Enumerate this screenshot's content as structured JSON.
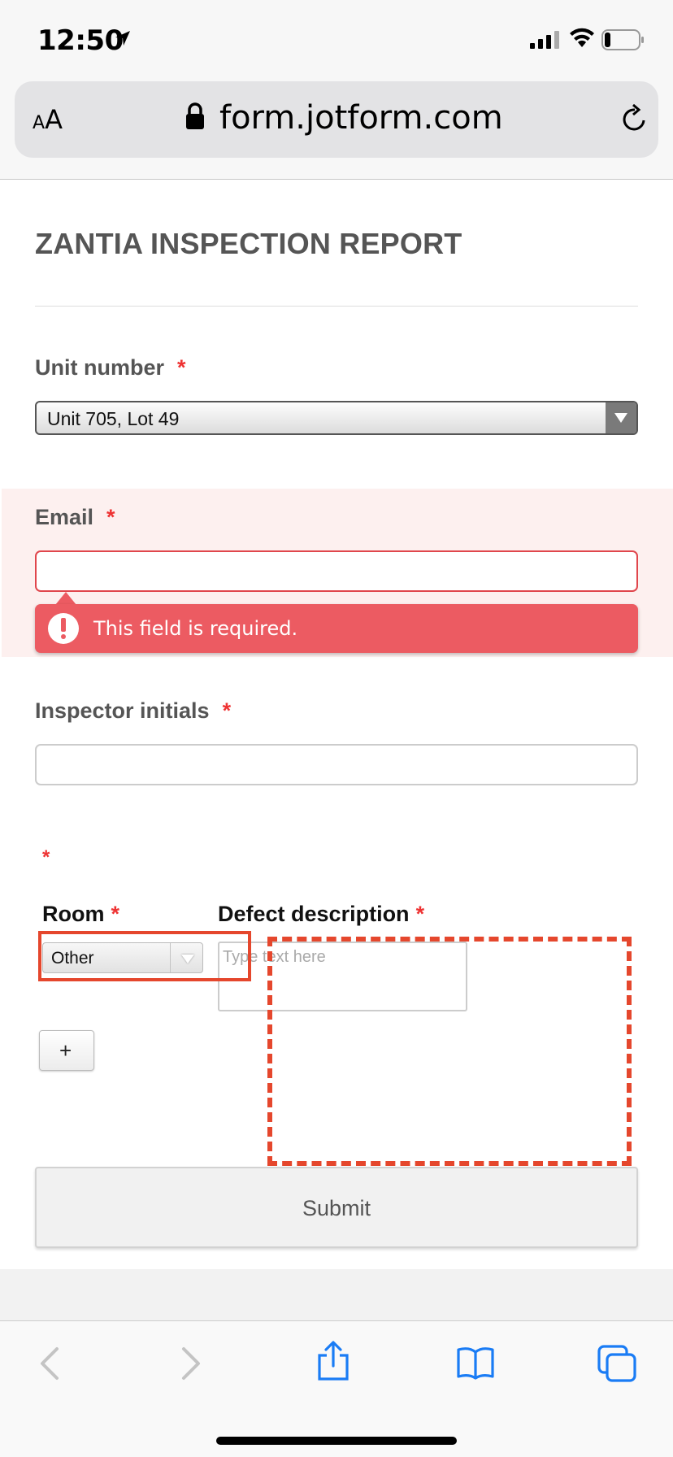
{
  "status_bar": {
    "time": "12:50"
  },
  "url_bar": {
    "aa_small": "A",
    "aa_large": "A",
    "url": "form.jotform.com"
  },
  "form": {
    "title": "ZANTIA INSPECTION REPORT",
    "required_mark": "*",
    "unit_number": {
      "label": "Unit number",
      "value": "Unit 705, Lot 49"
    },
    "email": {
      "label": "Email",
      "value": "",
      "error": "This field is required."
    },
    "inspector_initials": {
      "label": "Inspector initials",
      "value": ""
    },
    "table": {
      "room_label": "Room",
      "defect_label": "Defect description",
      "room_value": "Other",
      "defect_placeholder": "Type text here",
      "add_row": "+"
    },
    "submit": "Submit"
  },
  "colors": {
    "required": "#ee3333",
    "error": "#ec5b62",
    "annotation": "#e5472d",
    "ios_blue": "#1a7cf5"
  }
}
